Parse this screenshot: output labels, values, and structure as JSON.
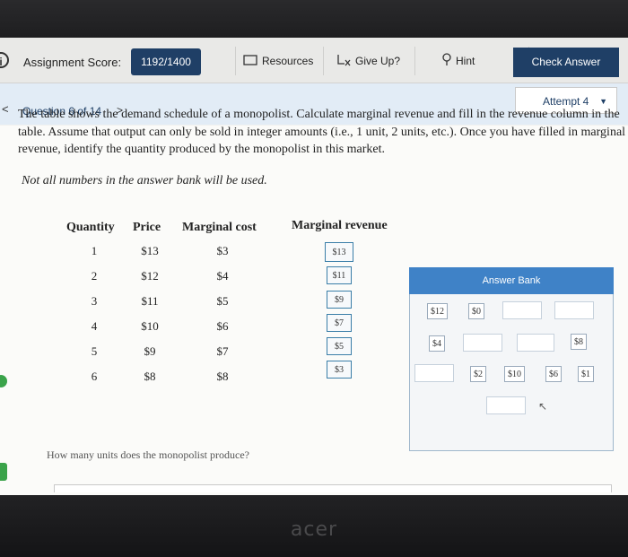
{
  "header": {
    "score_label": "Assignment Score:",
    "score_value": "1192/1400",
    "resources": "Resources",
    "give_up": "Give Up?",
    "hint": "Hint",
    "check_answer": "Check Answer"
  },
  "question_nav": {
    "prev": "<",
    "label": "Question 6 of 14",
    "next": ">",
    "attempt": "Attempt 4"
  },
  "problem": {
    "line1": "The table shows the demand schedule of a monopolist. Calculate marginal revenue and fill in the revenue column in the",
    "line2": "table. Assume that output can only be sold in integer amounts (i.e., 1 unit, 2 units, etc.). Once you have filled in marginal",
    "line3": "revenue, identify the quantity produced by the monopolist in this market.",
    "note": "Not all numbers in the answer bank will be used."
  },
  "table": {
    "headers": [
      "Quantity",
      "Price",
      "Marginal cost",
      "Marginal revenue"
    ],
    "rows": [
      {
        "q": "1",
        "price": "$13",
        "mc": "$3",
        "mr": "$13"
      },
      {
        "q": "2",
        "price": "$12",
        "mc": "$4",
        "mr": "$11"
      },
      {
        "q": "3",
        "price": "$11",
        "mc": "$5",
        "mr": "$9"
      },
      {
        "q": "4",
        "price": "$10",
        "mc": "$6",
        "mr": "$7"
      },
      {
        "q": "5",
        "price": "$9",
        "mc": "$7",
        "mr": "$5"
      },
      {
        "q": "6",
        "price": "$8",
        "mc": "$8",
        "mr": "$3"
      }
    ]
  },
  "answer_bank": {
    "title": "Answer Bank",
    "chips": [
      "$12",
      "$0",
      "$4",
      "$8",
      "$2",
      "$10",
      "$6",
      "$1"
    ]
  },
  "followup": {
    "question": "How many units does the monopolist produce?"
  },
  "device": {
    "brand": "acer"
  }
}
